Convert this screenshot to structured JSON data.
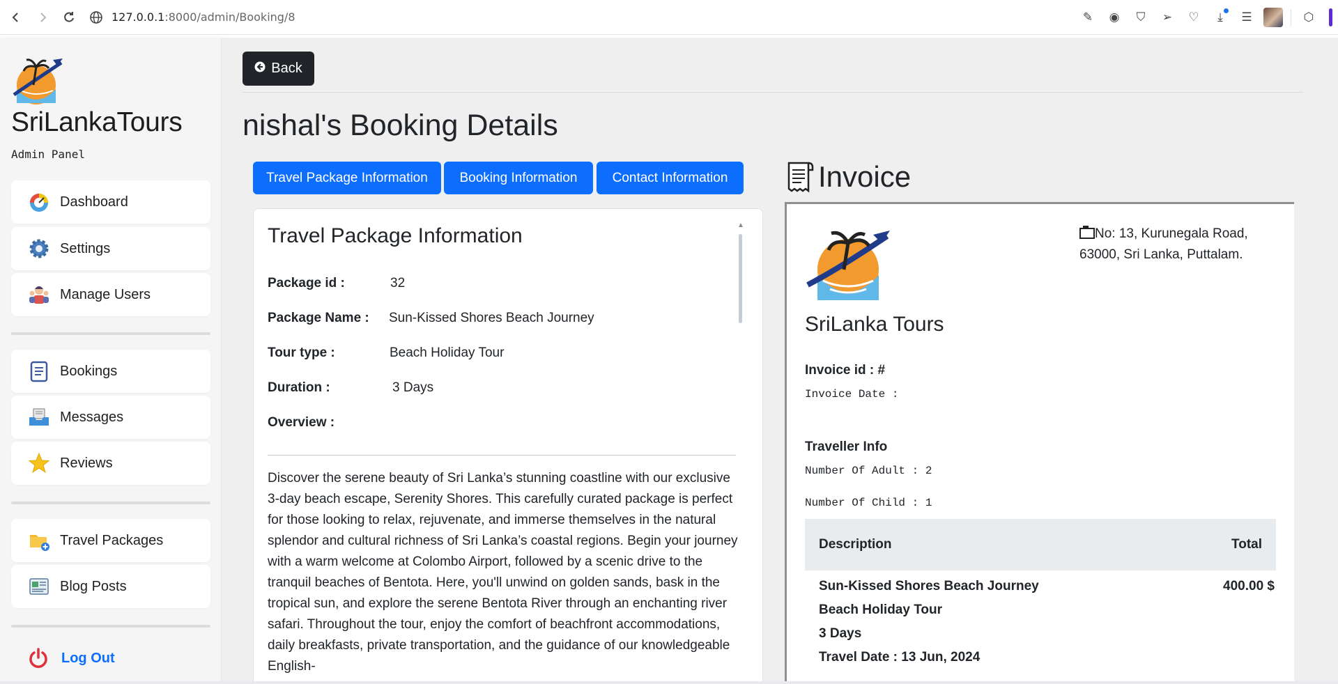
{
  "browser": {
    "url_host": "127.0.0.1",
    "url_path": ":8000/admin/Booking/8"
  },
  "sidebar": {
    "brand": "SriLankaTours",
    "subtitle": "Admin Panel",
    "items": [
      {
        "label": "Dashboard",
        "icon": "speedometer-icon"
      },
      {
        "label": "Settings",
        "icon": "gear-icon"
      },
      {
        "label": "Manage Users",
        "icon": "users-icon"
      },
      {
        "label": "Bookings",
        "icon": "clipboard-icon"
      },
      {
        "label": "Messages",
        "icon": "inbox-icon"
      },
      {
        "label": "Reviews",
        "icon": "star-icon"
      },
      {
        "label": "Travel Packages",
        "icon": "folder-add-icon"
      },
      {
        "label": "Blog Posts",
        "icon": "newspaper-icon"
      }
    ],
    "logout": "Log Out"
  },
  "main": {
    "back_label": "Back",
    "title_name": "nishal",
    "title_rest": "'s Booking Details",
    "tabs": [
      "Travel Package Information",
      "Booking Information",
      "Contact Information"
    ],
    "card": {
      "title": "Travel Package Information",
      "rows": [
        {
          "key": "Package id :",
          "value": "32"
        },
        {
          "key": "Package Name :",
          "value": "Sun-Kissed Shores Beach Journey"
        },
        {
          "key": "Tour type :",
          "value": "Beach Holiday Tour"
        },
        {
          "key": "Duration :",
          "value": "3 Days"
        },
        {
          "key": "Overview :",
          "value": ""
        }
      ],
      "overview": "Discover the serene beauty of Sri Lanka’s stunning coastline with our exclusive 3-day beach escape, Serenity Shores. This carefully curated package is perfect for those looking to relax, rejuvenate, and immerse themselves in the natural splendor and cultural richness of Sri Lanka’s coastal regions. Begin your journey with a warm welcome at Colombo Airport, followed by a scenic drive to the tranquil beaches of Bentota. Here, you'll unwind on golden sands, bask in the tropical sun, and explore the serene Bentota River through an enchanting river safari. Throughout the tour, enjoy the comfort of beachfront accommodations, daily breakfasts, private transportation, and the guidance of our knowledgeable English-"
    }
  },
  "invoice": {
    "heading": "Invoice",
    "address": "No: 13, Kurunegala Road, 63000, Sri Lanka, Puttalam.",
    "company": "SriLanka Tours",
    "invoice_id": "Invoice id : #",
    "invoice_date": "Invoice Date :",
    "traveller_heading": "Traveller Info",
    "adults": "Number Of Adult : 2",
    "children": "Number Of Child : 1",
    "col_description": "Description",
    "col_total": "Total",
    "line_package": "Sun-Kissed Shores Beach Journey",
    "line_type": "Beach Holiday Tour",
    "line_duration": "3 Days",
    "line_date": "Travel Date : 13 Jun, 2024",
    "line_total": "400.00 $"
  }
}
